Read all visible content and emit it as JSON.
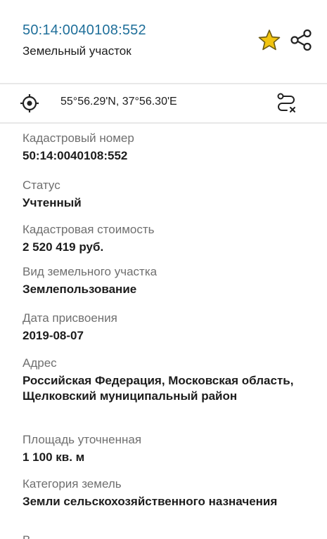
{
  "header": {
    "cadastral_link": "50:14:0040108:552",
    "subtitle": "Земельный участок",
    "star_color": "#f2c40f"
  },
  "location": {
    "coordinates": "55°56.29'N, 37°56.30'E"
  },
  "fields": [
    {
      "label": "Кадастровый номер",
      "value": "50:14:0040108:552"
    },
    {
      "label": "Статус",
      "value": "Учтенный"
    },
    {
      "label": "Кадастровая стоимость",
      "value": "2 520 419 руб."
    },
    {
      "label": "Вид земельного участка",
      "value": "Землепользование"
    },
    {
      "label": "Дата присвоения",
      "value": "2019-08-07"
    },
    {
      "label": "Адрес",
      "value": "Российская Федерация, Московская область, Щелковский муниципальный район"
    },
    {
      "label": "Площадь уточненная",
      "value": "1 100 кв. м"
    },
    {
      "label": "Категория земель",
      "value": "Земли сельскохозяйственного назначения"
    },
    {
      "label": "В",
      "value": ""
    }
  ]
}
